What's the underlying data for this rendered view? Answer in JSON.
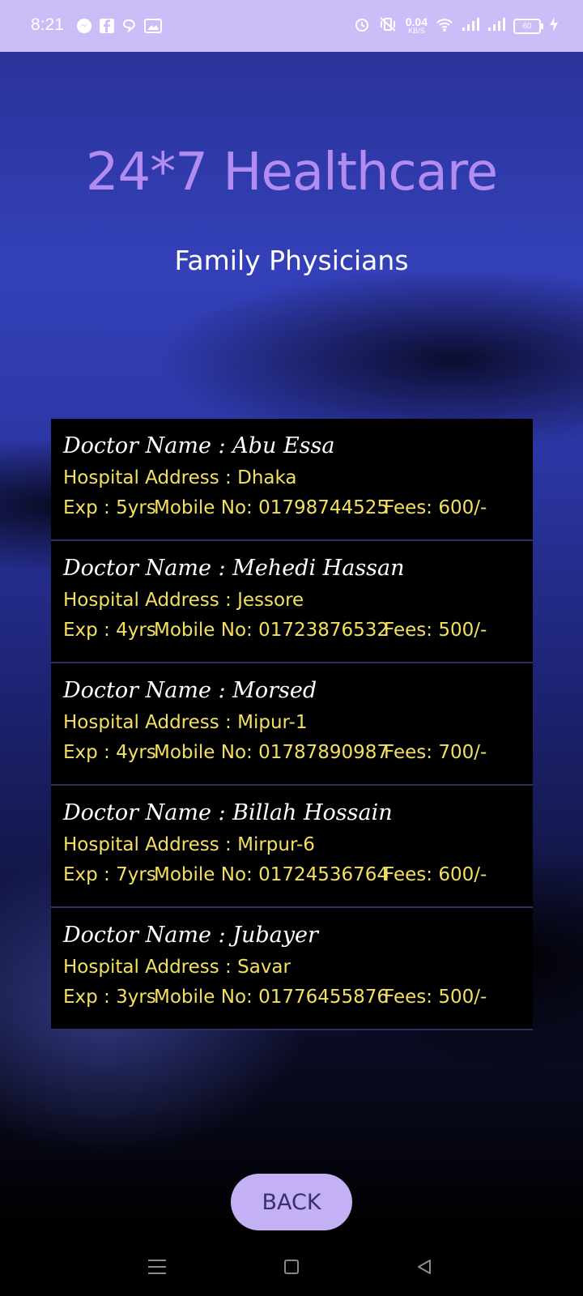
{
  "status_bar": {
    "time": "8:21",
    "net_speed_value": "0.04",
    "net_speed_unit": "KB/S",
    "battery": "60",
    "left_icons": [
      "messenger-icon",
      "facebook-icon",
      "messaging-app-icon",
      "gallery-icon"
    ],
    "right_icons": [
      "alarm-icon",
      "vibrate-off-icon",
      "wifi-icon",
      "signal-icon",
      "signal-icon",
      "battery-icon",
      "charging-icon"
    ]
  },
  "header": {
    "app_title": "24*7 Healthcare",
    "subtitle": "Family Physicians"
  },
  "doctors": [
    {
      "name_line": "Doctor Name : Abu Essa",
      "hospital_line": "Hospital Address : Dhaka",
      "exp": "Exp : 5yrs",
      "mobile": "Mobile No: 01798744525",
      "fees": "Fees: 600/-"
    },
    {
      "name_line": "Doctor Name : Mehedi Hassan",
      "hospital_line": "Hospital Address : Jessore",
      "exp": "Exp : 4yrs",
      "mobile": "Mobile No: 01723876532",
      "fees": "Fees: 500/-"
    },
    {
      "name_line": "Doctor Name : Morsed",
      "hospital_line": "Hospital Address : Mipur-1",
      "exp": "Exp : 4yrs",
      "mobile": "Mobile No: 01787890987",
      "fees": "Fees: 700/-"
    },
    {
      "name_line": "Doctor Name : Billah Hossain",
      "hospital_line": "Hospital Address : Mirpur-6",
      "exp": "Exp : 7yrs",
      "mobile": "Mobile No: 01724536764",
      "fees": "Fees: 600/-"
    },
    {
      "name_line": "Doctor Name : Jubayer",
      "hospital_line": "Hospital Address : Savar",
      "exp": "Exp : 3yrs",
      "mobile": "Mobile No: 01776455876",
      "fees": "Fees: 500/-"
    }
  ],
  "back_button": {
    "label": "BACK"
  },
  "colors": {
    "status_bar": "#cbbdf7",
    "title": "#b38cf2",
    "subtitle": "#ffffff",
    "card_bg": "#000000",
    "doctor_name": "#ffffff",
    "detail_text": "#f3e060",
    "back_button_bg": "#c3b0f5",
    "back_button_text": "#3a2f6e"
  },
  "nav_bar": {
    "icons": [
      "menu-icon",
      "home-icon",
      "back-arrow-icon"
    ]
  }
}
